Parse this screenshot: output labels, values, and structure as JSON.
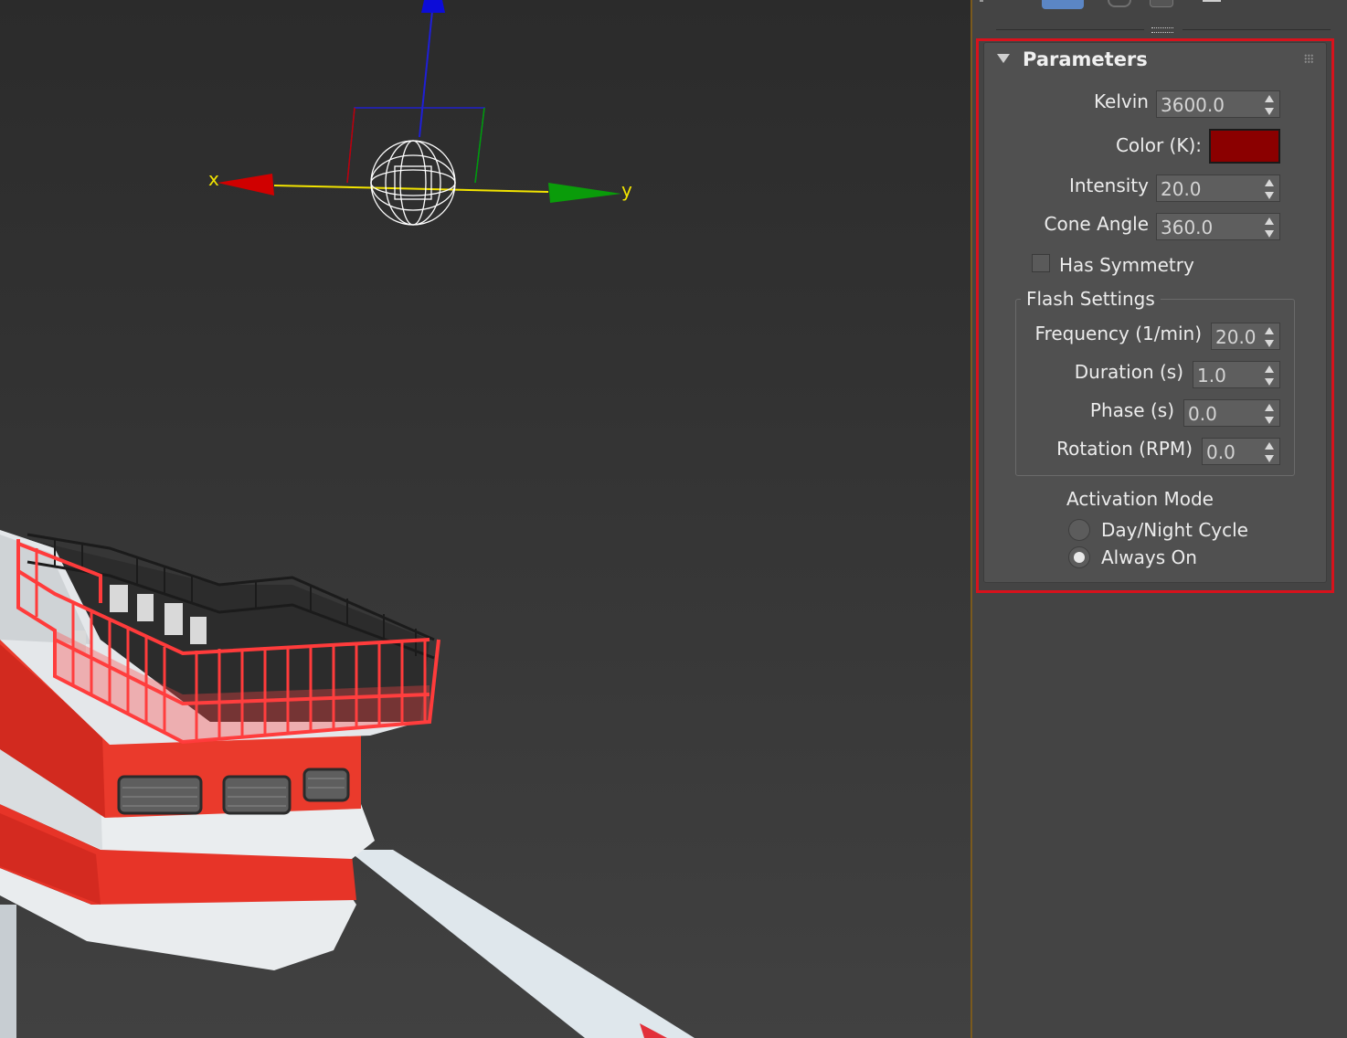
{
  "viewport": {
    "axes": {
      "x_label": "x",
      "y_label": "y"
    }
  },
  "panel": {
    "rollout": {
      "title": "Parameters",
      "kelvin": {
        "label": "Kelvin",
        "value": "3600.0"
      },
      "color": {
        "label": "Color (K):",
        "swatch": "#8b0000"
      },
      "intensity": {
        "label": "Intensity",
        "value": "20.0"
      },
      "cone_angle": {
        "label": "Cone Angle",
        "value": "360.0"
      },
      "has_symmetry": {
        "label": "Has Symmetry",
        "checked": false
      },
      "flash_settings": {
        "title": "Flash Settings",
        "frequency": {
          "label": "Frequency (1/min)",
          "value": "20.0"
        },
        "duration": {
          "label": "Duration (s)",
          "value": "1.0"
        },
        "phase": {
          "label": "Phase (s)",
          "value": "0.0"
        },
        "rotation": {
          "label": "Rotation (RPM)",
          "value": "0.0"
        }
      },
      "activation_mode": {
        "title": "Activation Mode",
        "options": [
          {
            "label": "Day/Night Cycle",
            "selected": false
          },
          {
            "label": "Always On",
            "selected": true
          }
        ]
      }
    }
  },
  "colors": {
    "highlight": "#d8121c",
    "axis_x": "#cc0000",
    "axis_y": "#00a000",
    "axis_z": "#0000cc",
    "tower_red": "#e8312b",
    "tower_white": "#e6e8ea"
  }
}
